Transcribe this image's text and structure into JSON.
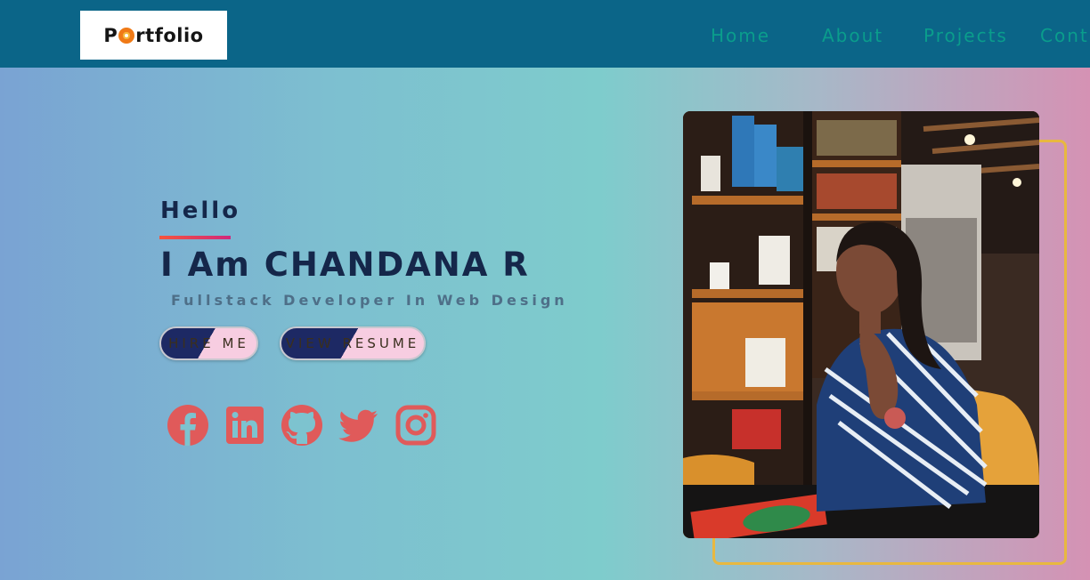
{
  "nav": {
    "logo": "Portfolio",
    "logo_prefix": "P",
    "logo_suffix": "rtfolio",
    "items": [
      "Home",
      "About",
      "Projects",
      "Cont"
    ]
  },
  "hero": {
    "greeting": "Hello",
    "name": "I Am CHANDANA R",
    "subtitle": "Fullstack Developer In Web Design",
    "buttons": {
      "hire": "HIRE ME",
      "resume": "VIEW RESUME"
    },
    "social": [
      "facebook-icon",
      "linkedin-icon",
      "github-icon",
      "twitter-icon",
      "instagram-icon"
    ]
  },
  "photo": {
    "alt": "Portrait photo"
  },
  "colors": {
    "navbar": "#0b6588",
    "nav_text": "#0a9d8c",
    "heading": "#15274a",
    "accent": "#e8b840",
    "social": "#e05a5a"
  }
}
